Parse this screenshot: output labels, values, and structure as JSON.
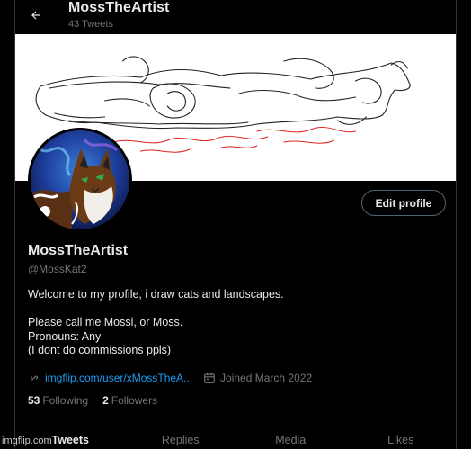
{
  "header": {
    "title": "MossTheArtist",
    "tweet_count": "43 Tweets",
    "back_icon": "arrow-left-icon"
  },
  "profile": {
    "display_name": "MossTheArtist",
    "handle": "@MossKat2",
    "edit_label": "Edit profile",
    "bio": [
      "Welcome to my profile, i draw cats and landscapes.",
      "",
      "Please call me Mossi, or Moss.",
      "Pronouns: Any",
      "(I dont do commissions ppls)"
    ],
    "website": "imgflip.com/user/xMossTheA...",
    "joined": "Joined March 2022",
    "following_count": "53",
    "following_label": "Following",
    "followers_count": "2",
    "followers_label": "Followers"
  },
  "tabs": [
    {
      "label": "Tweets",
      "active": true
    },
    {
      "label": "Replies",
      "active": false
    },
    {
      "label": "Media",
      "active": false
    },
    {
      "label": "Likes",
      "active": false
    }
  ],
  "watermark": "imgflip.com",
  "colors": {
    "background": "#000000",
    "link": "#1d9bf0",
    "muted": "#71767b",
    "text": "#e7e9ea"
  }
}
